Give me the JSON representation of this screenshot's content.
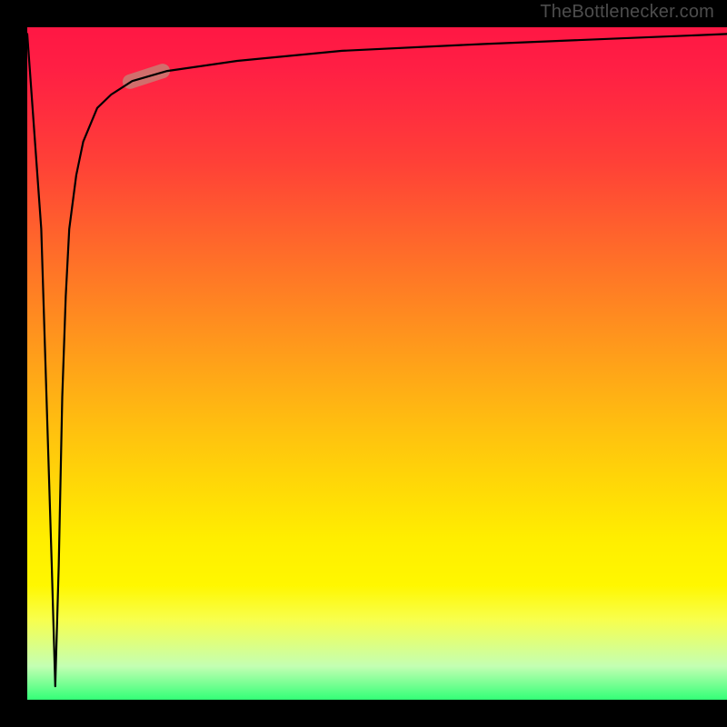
{
  "watermark": "TheBottlenecker.com",
  "colors": {
    "frame_bg": "#000000",
    "gradient_top": "#ff1744",
    "gradient_mid": "#ffee00",
    "gradient_bot": "#33ff77",
    "curve_stroke": "#000000",
    "marker_fill": "#c97b73",
    "watermark_text": "#4d4d4d"
  },
  "chart_data": {
    "type": "line",
    "title": "",
    "xlabel": "",
    "ylabel": "",
    "xlim": [
      0,
      100
    ],
    "ylim": [
      0,
      100
    ],
    "note": "No axes, ticks, or units are rendered in the image. x/y values below are in percent of plot width/height, read off the curve geometry. The curve dips sharply to y≈0 near x≈4, then rises steeply and asymptotes toward y≈100.",
    "series": [
      {
        "name": "curve",
        "x": [
          0,
          2,
          3.5,
          4,
          4.5,
          5,
          5.5,
          6,
          7,
          8,
          10,
          12,
          15,
          20,
          30,
          45,
          65,
          100
        ],
        "y": [
          99,
          70,
          20,
          2,
          20,
          45,
          60,
          70,
          78,
          83,
          88,
          90,
          92,
          93.5,
          95,
          96.5,
          97.5,
          99
        ]
      }
    ],
    "marker": {
      "shape": "pill",
      "x": 17,
      "y": 92.7,
      "angle_deg": -18
    },
    "background_gradient": {
      "direction": "vertical",
      "stops": [
        {
          "pos": 0,
          "color": "#ff1744"
        },
        {
          "pos": 20,
          "color": "#ff4037"
        },
        {
          "pos": 44,
          "color": "#ff8e1f"
        },
        {
          "pos": 68,
          "color": "#ffd807"
        },
        {
          "pos": 83,
          "color": "#fff700"
        },
        {
          "pos": 95,
          "color": "#c4ffb3"
        },
        {
          "pos": 100,
          "color": "#33ff77"
        }
      ]
    }
  }
}
